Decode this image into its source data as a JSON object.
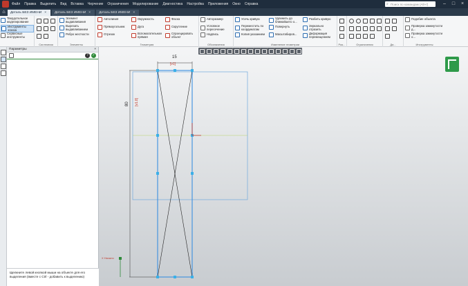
{
  "menu": {
    "items": [
      "Файл",
      "Правка",
      "Выделить",
      "Вид",
      "Вставка",
      "Черчение",
      "Ограничения",
      "Моделирование",
      "Диагностика",
      "Настройка",
      "Приложения",
      "Окно",
      "Справка"
    ],
    "search_placeholder": "Поиск по командам (Alt+/)"
  },
  "tabs": [
    {
      "label": "Деталь БЕЗ ИМЕНИ",
      "active": true
    },
    {
      "label": "Деталь БЕЗ ИМЕНИ",
      "active": false
    },
    {
      "label": "Деталь БЕЗ ИМЕНИ",
      "active": false
    }
  ],
  "ribbon": {
    "left_buttons": [
      "Твердотельное моделирование",
      "Инструменты эскиза",
      "Сервисные инструменты"
    ],
    "groups": [
      {
        "caption": "Системная"
      },
      {
        "caption": "Элементы"
      },
      {
        "caption": "Геометрия"
      },
      {
        "caption": "Обозначения"
      },
      {
        "caption": "Изменение геометрии"
      },
      {
        "caption": "Раз..."
      },
      {
        "caption": "Ограничения"
      },
      {
        "caption": "Ди..."
      },
      {
        "caption": "Инструменты"
      }
    ],
    "elements": [
      "Элемент выдавливания",
      "Вырезать выдавливанием",
      "Ребро жесткости"
    ],
    "geometry": [
      "Автолиния",
      "Окружность",
      "Фаска",
      "Прямоугольник",
      "Дуга",
      "Скругление",
      "Отрезок",
      "Вспомогательная прямая",
      "Спроецировать объект"
    ],
    "annotations": [
      "Авторазмер",
      "Условное пересечение",
      "Надпись"
    ],
    "modify": [
      "Усечь кривую",
      "Удлинить до ближайшего о...",
      "Разбить кривую",
      "Переместить по координатам",
      "Повернуть",
      "Зеркально отразить",
      "Копия указанием",
      "Масштабиров...",
      "Деформация перемещением"
    ],
    "tools": [
      "Подобие объекта",
      "Проверка замкнутости д...",
      "Проверка замкнутости о..."
    ]
  },
  "params_panel": {
    "title": "Параметры",
    "hint": "Щелкните левой кнопкой мыши на объекте для его выделения (вместе с Ctrl - добавить к выделению)"
  },
  "drawing": {
    "dim_width": "15",
    "dim_width_expr": "[v1]",
    "dim_height": "80",
    "dim_height_expr": "[v1.8]",
    "origin_label": "X  Начало"
  },
  "colors": {
    "titlebar": "#1f2d3d",
    "ok": "#2f8a3a",
    "sketch": "#3a8fe0"
  }
}
